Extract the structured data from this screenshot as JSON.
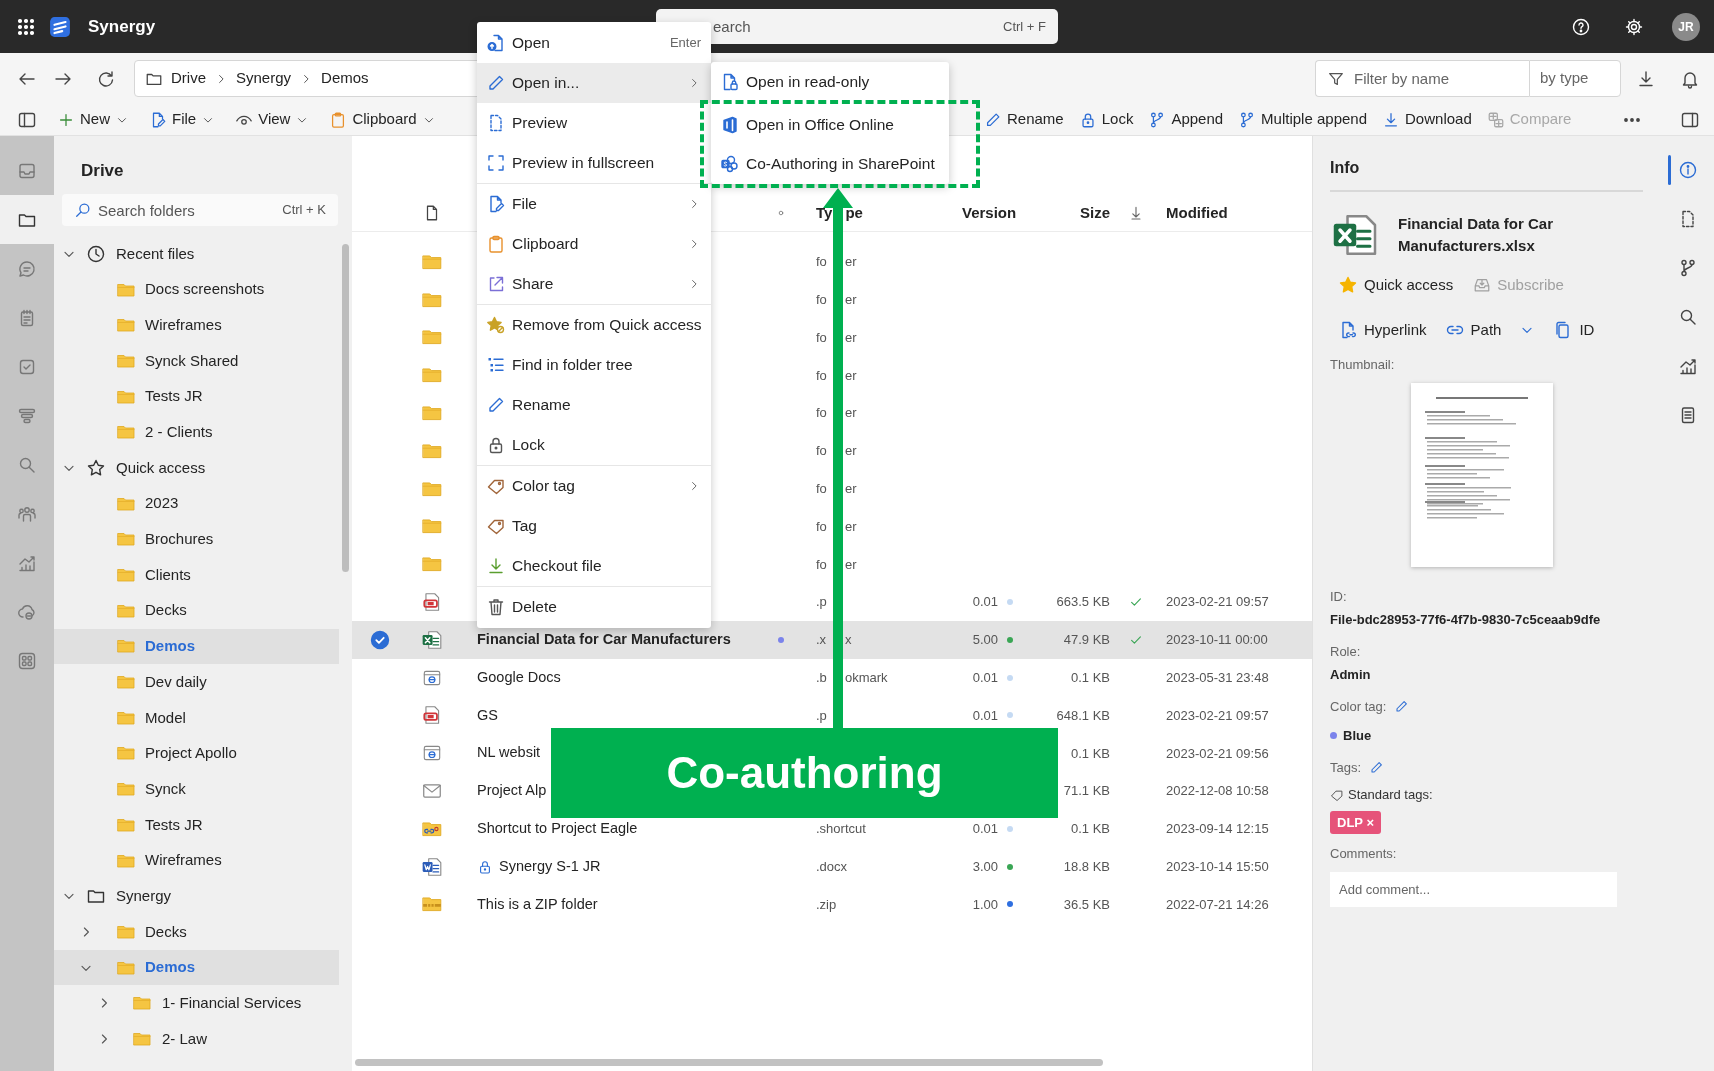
{
  "app": {
    "name": "Synergy",
    "search": {
      "placeholder": "earch",
      "shortcut": "Ctrl + F"
    },
    "avatar": "JR"
  },
  "breadcrumb": [
    "Drive",
    "Synergy",
    "Demos"
  ],
  "filter": {
    "placeholder": "Filter by name",
    "type_label": "by type"
  },
  "toolbar_left": [
    {
      "label": "New"
    },
    {
      "label": "File"
    },
    {
      "label": "View"
    },
    {
      "label": "Clipboard"
    }
  ],
  "toolbar_right": [
    {
      "label": "Rename",
      "disabled": false
    },
    {
      "label": "Lock",
      "disabled": false
    },
    {
      "label": "Append",
      "disabled": false
    },
    {
      "label": "Multiple append",
      "disabled": false
    },
    {
      "label": "Download",
      "disabled": false
    },
    {
      "label": "Compare",
      "disabled": true
    }
  ],
  "left_rail": [
    {
      "selected": false
    },
    {
      "selected": true
    },
    {
      "selected": false
    },
    {
      "selected": false
    },
    {
      "selected": false
    },
    {
      "selected": false
    },
    {
      "selected": false
    },
    {
      "selected": false
    },
    {
      "selected": false
    },
    {
      "selected": false
    },
    {
      "selected": false
    }
  ],
  "tree": {
    "title": "Drive",
    "search": {
      "placeholder": "Search folders",
      "shortcut": "Ctrl + K"
    },
    "items": [
      {
        "label": "Recent files",
        "kind": "recent",
        "expanded": true,
        "selected": false,
        "children": [
          {
            "label": "Docs screenshots",
            "kind": "folder",
            "selected": false
          },
          {
            "label": "Wireframes",
            "kind": "folder",
            "selected": false
          },
          {
            "label": "Synck Shared",
            "kind": "folder",
            "selected": false
          },
          {
            "label": "Tests JR",
            "kind": "folder",
            "selected": false
          },
          {
            "label": "2 - Clients",
            "kind": "folder",
            "selected": false
          }
        ]
      },
      {
        "label": "Quick access",
        "kind": "quick",
        "expanded": true,
        "selected": false,
        "children": [
          {
            "label": "2023",
            "kind": "folder",
            "selected": false
          },
          {
            "label": "Brochures",
            "kind": "folder",
            "selected": false
          },
          {
            "label": "Clients",
            "kind": "folder",
            "selected": false
          },
          {
            "label": "Decks",
            "kind": "folder",
            "selected": false
          },
          {
            "label": "Demos",
            "kind": "folder",
            "selected": true
          },
          {
            "label": "Dev daily",
            "kind": "folder",
            "selected": false
          },
          {
            "label": "Model",
            "kind": "folder",
            "selected": false
          },
          {
            "label": "Project Apollo",
            "kind": "folder",
            "selected": false
          },
          {
            "label": "Synck",
            "kind": "folder",
            "selected": false
          },
          {
            "label": "Tests JR",
            "kind": "folder",
            "selected": false
          },
          {
            "label": "Wireframes",
            "kind": "folder",
            "selected": false
          }
        ]
      },
      {
        "label": "Synergy",
        "kind": "drive",
        "expanded": true,
        "selected": false,
        "children": [
          {
            "label": "Decks",
            "kind": "folder",
            "expanded": false,
            "selected": false
          },
          {
            "label": "Demos",
            "kind": "folder",
            "expanded": true,
            "selected": true,
            "children": [
              {
                "label": "1- Financial Services",
                "kind": "folder",
                "expanded": false,
                "selected": false
              },
              {
                "label": "2- Law",
                "kind": "folder",
                "expanded": false,
                "selected": false
              }
            ]
          }
        ]
      }
    ]
  },
  "files": {
    "header": {
      "type_parts": [
        "Ty",
        "pe"
      ],
      "version": "Version",
      "size": "Size",
      "modified": "Modified"
    },
    "rows": [
      {
        "kind": "folder",
        "type_parts": [
          "fo",
          "er"
        ],
        "selected": false,
        "locked": false,
        "synced": false
      },
      {
        "kind": "folder",
        "type_parts": [
          "fo",
          "er"
        ],
        "selected": false,
        "locked": false,
        "synced": false
      },
      {
        "kind": "folder",
        "type_parts": [
          "fo",
          "er"
        ],
        "selected": false,
        "locked": false,
        "synced": false
      },
      {
        "kind": "folder",
        "type_parts": [
          "fo",
          "er"
        ],
        "selected": false,
        "locked": false,
        "synced": false
      },
      {
        "kind": "folder",
        "type_parts": [
          "fo",
          "er"
        ],
        "selected": false,
        "locked": false,
        "synced": false
      },
      {
        "kind": "folder",
        "type_parts": [
          "fo",
          "er"
        ],
        "selected": false,
        "locked": false,
        "synced": false
      },
      {
        "kind": "folder",
        "type_parts": [
          "fo",
          "er"
        ],
        "selected": false,
        "locked": false,
        "synced": false
      },
      {
        "kind": "folder",
        "type_parts": [
          "fo",
          "er"
        ],
        "selected": false,
        "locked": false,
        "synced": false
      },
      {
        "kind": "folder",
        "type_parts": [
          "fo",
          "er"
        ],
        "selected": false,
        "locked": false,
        "synced": false
      },
      {
        "kind": "pdf",
        "type_parts": [
          ".p"
        ],
        "version": {
          "text": "0.01",
          "color": "#c5daf3"
        },
        "size": "663.5 KB",
        "synced": true,
        "modified": "2023-02-21 09:57",
        "selected": false,
        "locked": false
      },
      {
        "kind": "excel",
        "name": "Financial Data for Car Manufacturers",
        "color_tag": {
          "color": "#7b83eb"
        },
        "type_parts": [
          ".x",
          "x"
        ],
        "version": {
          "text": "5.00",
          "color": "#3aa655"
        },
        "size": "47.9 KB",
        "synced": true,
        "modified": "2023-10-11 00:00",
        "selected": true,
        "locked": false
      },
      {
        "kind": "bookmark",
        "name": "Google Docs",
        "type_parts": [
          ".b",
          "okmark"
        ],
        "version": {
          "text": "0.01",
          "color": "#c5daf3"
        },
        "size": "0.1 KB",
        "synced": false,
        "modified": "2023-05-31 23:48",
        "selected": false,
        "locked": false
      },
      {
        "kind": "pdf",
        "name": "GS",
        "type_parts": [
          ".p"
        ],
        "version": {
          "text": "0.01",
          "color": "#c5daf3"
        },
        "size": "648.1 KB",
        "synced": false,
        "modified": "2023-02-21 09:57",
        "selected": false,
        "locked": false
      },
      {
        "kind": "bookmark",
        "name": "NL websit",
        "size": "0.1 KB",
        "synced": false,
        "modified": "2023-02-21 09:56",
        "selected": false,
        "locked": false
      },
      {
        "kind": "email",
        "name": "Project Alp",
        "size": "71.1 KB",
        "synced": false,
        "modified": "2022-12-08 10:58",
        "selected": false,
        "locked": false
      },
      {
        "kind": "shortcut",
        "name": "Shortcut to Project Eagle",
        "type_parts": [
          ".shortcut"
        ],
        "version": {
          "text": "0.01",
          "color": "#c5daf3"
        },
        "size": "0.1 KB",
        "synced": false,
        "modified": "2023-09-14 12:15",
        "selected": false,
        "locked": false
      },
      {
        "kind": "word",
        "name": "Synergy S-1 JR",
        "type_parts": [
          ".docx"
        ],
        "version": {
          "text": "3.00",
          "color": "#3aa655"
        },
        "size": "18.8 KB",
        "synced": false,
        "modified": "2023-10-14 15:50",
        "selected": false,
        "locked": true
      },
      {
        "kind": "zip",
        "name": "This is a ZIP folder",
        "type_parts": [
          ".zip"
        ],
        "version": {
          "text": "1.00",
          "color": "#2f6fe0"
        },
        "size": "36.5 KB",
        "synced": false,
        "modified": "2022-07-21 14:26",
        "selected": false,
        "locked": false
      }
    ]
  },
  "context_menu": {
    "groups": [
      [
        {
          "label": "Open",
          "shortcut": "Enter",
          "submenu": false,
          "highlighted": false
        },
        {
          "label": "Open in...",
          "submenu": true,
          "highlighted": true
        },
        {
          "label": "Preview",
          "submenu": false,
          "highlighted": false
        },
        {
          "label": "Preview in fullscreen",
          "submenu": false,
          "highlighted": false
        }
      ],
      [
        {
          "label": "File",
          "submenu": true,
          "highlighted": false
        },
        {
          "label": "Clipboard",
          "submenu": true,
          "highlighted": false
        },
        {
          "label": "Share",
          "submenu": true,
          "highlighted": false
        }
      ],
      [
        {
          "label": "Remove from Quick access",
          "submenu": false,
          "highlighted": false
        },
        {
          "label": "Find in folder tree",
          "submenu": false,
          "highlighted": false
        },
        {
          "label": "Rename",
          "submenu": false,
          "highlighted": false
        },
        {
          "label": "Lock",
          "submenu": false,
          "highlighted": false
        }
      ],
      [
        {
          "label": "Color tag",
          "submenu": true,
          "highlighted": false
        },
        {
          "label": "Tag",
          "submenu": false,
          "highlighted": false
        },
        {
          "label": "Checkout file",
          "submenu": false,
          "highlighted": false
        }
      ],
      [
        {
          "label": "Delete",
          "submenu": false,
          "highlighted": false
        }
      ]
    ]
  },
  "submenu": [
    {
      "label": "Open in read-only"
    },
    {
      "label": "Open in Office Online"
    },
    {
      "label": "Co-Authoring in SharePoint"
    }
  ],
  "callout": {
    "text": "Co-authoring"
  },
  "info": {
    "title": "Info",
    "file_name": "Financial Data for Car Manufacturers.xlsx",
    "quick_access": {
      "label": "Quick access",
      "on": true
    },
    "subscribe": {
      "label": "Subscribe",
      "disabled": true
    },
    "links": [
      "Hyperlink",
      "Path",
      "ID"
    ],
    "thumbnail_label": "Thumbnail:",
    "fields": [
      {
        "label": "ID:",
        "value": "File-bdc28953-77f6-4f7b-9830-7c5ceaab9dfe"
      },
      {
        "label": "Role:",
        "value": "Admin"
      }
    ],
    "color_tag": {
      "label": "Color tag:",
      "value": "Blue",
      "color": "#7b83eb"
    },
    "tags_label": "Tags:",
    "standard_tags_label": "Standard tags:",
    "tags": [
      {
        "label": "DLP",
        "remove": "×",
        "color": "#e6537a"
      }
    ],
    "comments": {
      "label": "Comments:",
      "placeholder": "Add comment..."
    }
  },
  "right_rail": [
    {
      "selected": true
    },
    {
      "selected": false
    },
    {
      "selected": false
    },
    {
      "selected": false
    },
    {
      "selected": false
    },
    {
      "selected": false
    }
  ]
}
